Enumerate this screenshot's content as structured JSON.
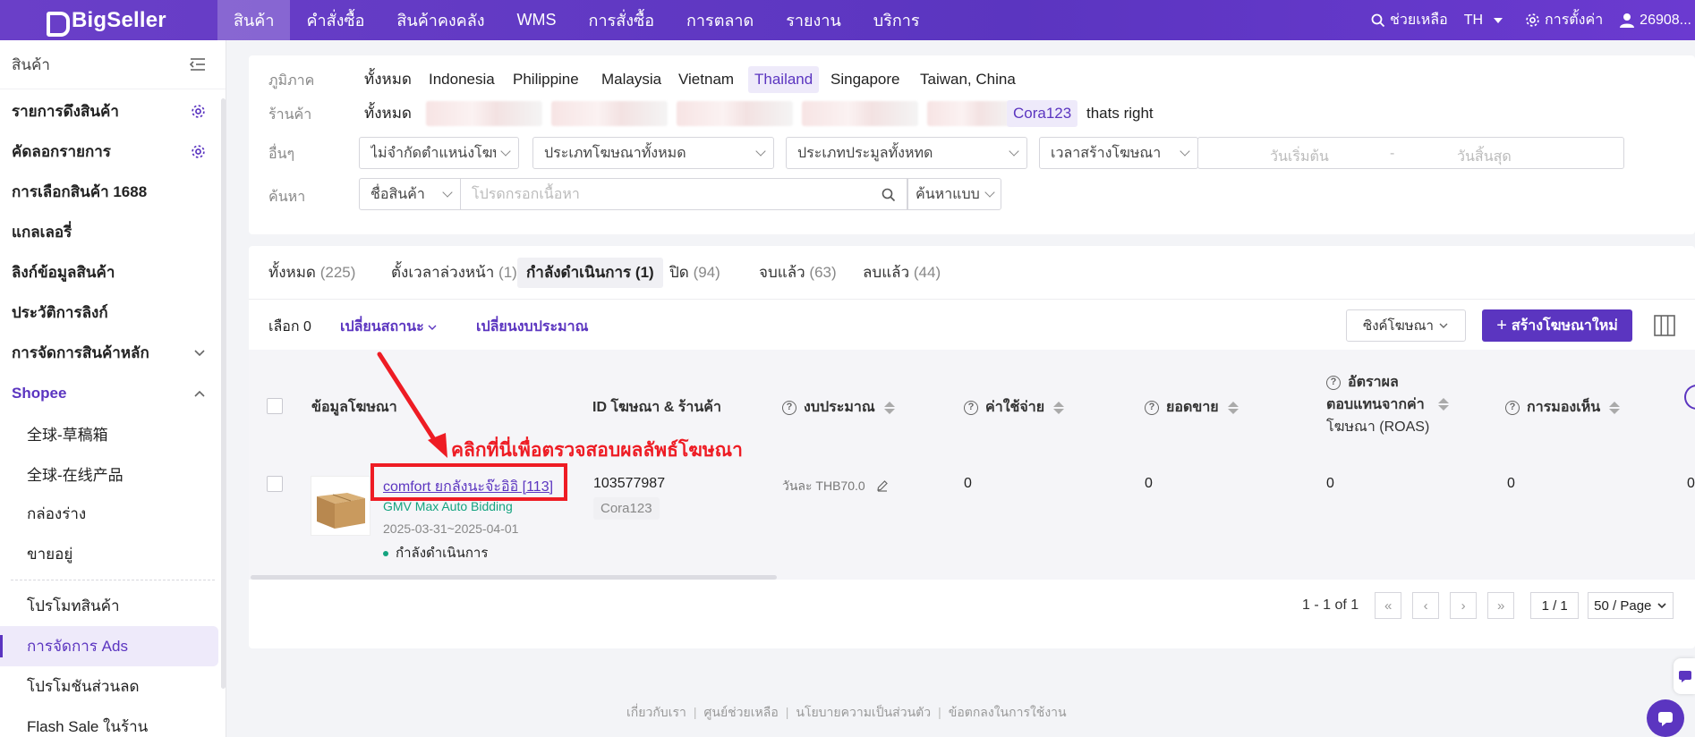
{
  "app": {
    "name": "BigSeller"
  },
  "topnav": {
    "items": [
      "สินค้า",
      "คำสั่งซื้อ",
      "สินค้าคงคลัง",
      "WMS",
      "การสั่งซื้อ",
      "การตลาด",
      "รายงาน",
      "บริการ"
    ],
    "help": "ช่วยเหลือ",
    "lang": "TH",
    "settings": "การตั้งค่า",
    "user": "26908..."
  },
  "sidebar": {
    "title": "สินค้า",
    "items": [
      {
        "label": "รายการดึงสินค้า"
      },
      {
        "label": "คัดลอกรายการ"
      },
      {
        "label": "การเลือกสินค้า 1688"
      },
      {
        "label": "แกลเลอรี่"
      },
      {
        "label": "ลิงก์ข้อมูลสินค้า"
      },
      {
        "label": "ประวัติการลิงก์"
      },
      {
        "label": "การจัดการสินค้าหลัก"
      },
      {
        "label": "Shopee"
      }
    ],
    "sub_items": [
      "全球-草稿箱",
      "全球-在线产品",
      "กล่องร่าง",
      "ขายอยู่"
    ],
    "sub_items2": [
      "โปรโมทสินค้า",
      "การจัดการ Ads",
      "โปรโมชันส่วนลด",
      "Flash Sale ในร้าน"
    ]
  },
  "filters": {
    "region_label": "ภูมิภาค",
    "regions": [
      "ทั้งหมด",
      "Indonesia",
      "Philippine",
      "Malaysia",
      "Vietnam",
      "Thailand",
      "Singapore",
      "Taiwan, China"
    ],
    "shop_label": "ร้านค้า",
    "shop_all": "ทั้งหมด",
    "shops": [
      "Cora123",
      "thats right"
    ],
    "other_label": "อื่นๆ",
    "sel_location": "ไม่จำกัดตำแหน่งโฆษณา",
    "sel_adtype": "ประเภทโฆษณาทั้งหมด",
    "sel_bidtype": "ประเภทประมูลทั้งหทด",
    "sel_time": "เวลาสร้างโฆษณา",
    "date_start": "วันเริ่มต้น",
    "date_sep": "-",
    "date_end": "วันสิ้นสุด",
    "search_label": "ค้นหา",
    "search_field": "ชื่อสินค้า",
    "search_placeholder": "โปรดกรอกเนื้อหา",
    "search_mode": "ค้นหาแบบ..."
  },
  "tabs": [
    {
      "label": "ทั้งหมด",
      "count": "(225)"
    },
    {
      "label": "ตั้งเวลาล่วงหน้า",
      "count": "(1)"
    },
    {
      "label": "กำลังดำเนินการ",
      "count": "(1)"
    },
    {
      "label": "ปิด",
      "count": "(94)"
    },
    {
      "label": "จบแล้ว",
      "count": "(63)"
    },
    {
      "label": "ลบแล้ว",
      "count": "(44)"
    }
  ],
  "toolbar": {
    "selected": "เลือก 0",
    "change_status": "เปลี่ยนสถานะ",
    "change_budget": "เปลี่ยนงบประมาณ",
    "sync_ads": "ซิงค์โฆษณา",
    "create_ad": "สร้างโฆษณาใหม่"
  },
  "table": {
    "headers": {
      "ad_info": "ข้อมูลโฆษณา",
      "id_shop": "ID โฆษณา & ร้านค้า",
      "budget": "งบประมาณ",
      "cost": "ค่าใช้จ่าย",
      "sales": "ยอดขาย",
      "roas_1": "อัตราผล",
      "roas_2": "ตอบแทนจากค่า",
      "roas_3": "โฆษณา (ROAS)",
      "impressions": "การมองเห็น"
    },
    "rows": [
      {
        "ad_name": "comfort ยกลังนะจ๊ะอิอิ [113]",
        "bidding": "GMV Max Auto Bidding",
        "period": "2025-03-31~2025-04-01",
        "status": "กำลังดำเนินการ",
        "ad_id": "103577987",
        "shop": "Cora123",
        "budget": "วันละ THB70.0",
        "cost": "0",
        "sales": "0",
        "roas": "0",
        "impressions": "0",
        "next": "0"
      }
    ]
  },
  "annotation": {
    "text": "คลิกที่นี่เพื่อตรวจสอบผลลัพธ์โฆษณา",
    "color": "#ee1c24"
  },
  "pagination": {
    "summary": "1 - 1 of 1",
    "page": "1 / 1",
    "page_size": "50 / Page"
  },
  "footer": {
    "links": [
      "เกี่ยวกับเรา",
      "ศูนย์ช่วยเหลือ",
      "นโยบายความเป็นส่วนตัว",
      "ข้อตกลงในการใช้งาน"
    ]
  },
  "colors": {
    "brand": "#5b35c0",
    "success": "#14a37f",
    "annotation": "#ee1c24"
  }
}
